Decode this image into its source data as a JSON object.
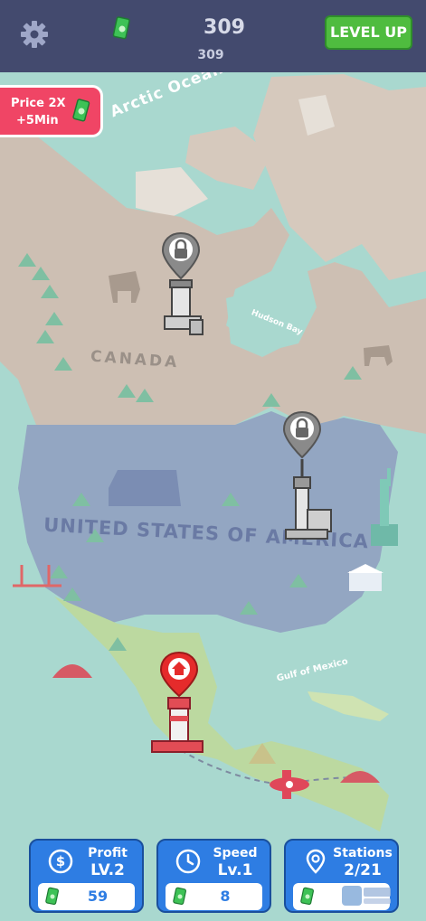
{
  "header": {
    "money_main": "309",
    "money_sub": "309",
    "level_up_label": "LEVEL UP"
  },
  "boost": {
    "line1": "Price 2X",
    "line2": "+5Min"
  },
  "map": {
    "labels": {
      "arctic": "Arctic Ocean",
      "canada": "CANADA",
      "hudson": "Hudson Bay",
      "usa": "UNITED STATES OF AMERICA",
      "gulf": "Gulf of Mexico"
    }
  },
  "stations": [
    {
      "name": "canada-tower",
      "state": "locked"
    },
    {
      "name": "toronto-tower",
      "state": "locked"
    },
    {
      "name": "mexico-tower",
      "state": "active"
    }
  ],
  "upgrades": {
    "profit": {
      "title": "Profit",
      "level": "LV.2",
      "cost": "59"
    },
    "speed": {
      "title": "Speed",
      "level": "Lv.1",
      "cost": "8"
    },
    "stations": {
      "title": "Stations",
      "level": "2/21"
    }
  },
  "colors": {
    "topbar": "#434a6e",
    "level_up": "#4fbc3f",
    "boost": "#f04565",
    "upgrade_button": "#2e7de3",
    "ocean": "#a9d8cf",
    "canada_land": "#cdbfb3",
    "usa_land": "#93a6c2",
    "mexico_land": "#bcd9a0"
  }
}
